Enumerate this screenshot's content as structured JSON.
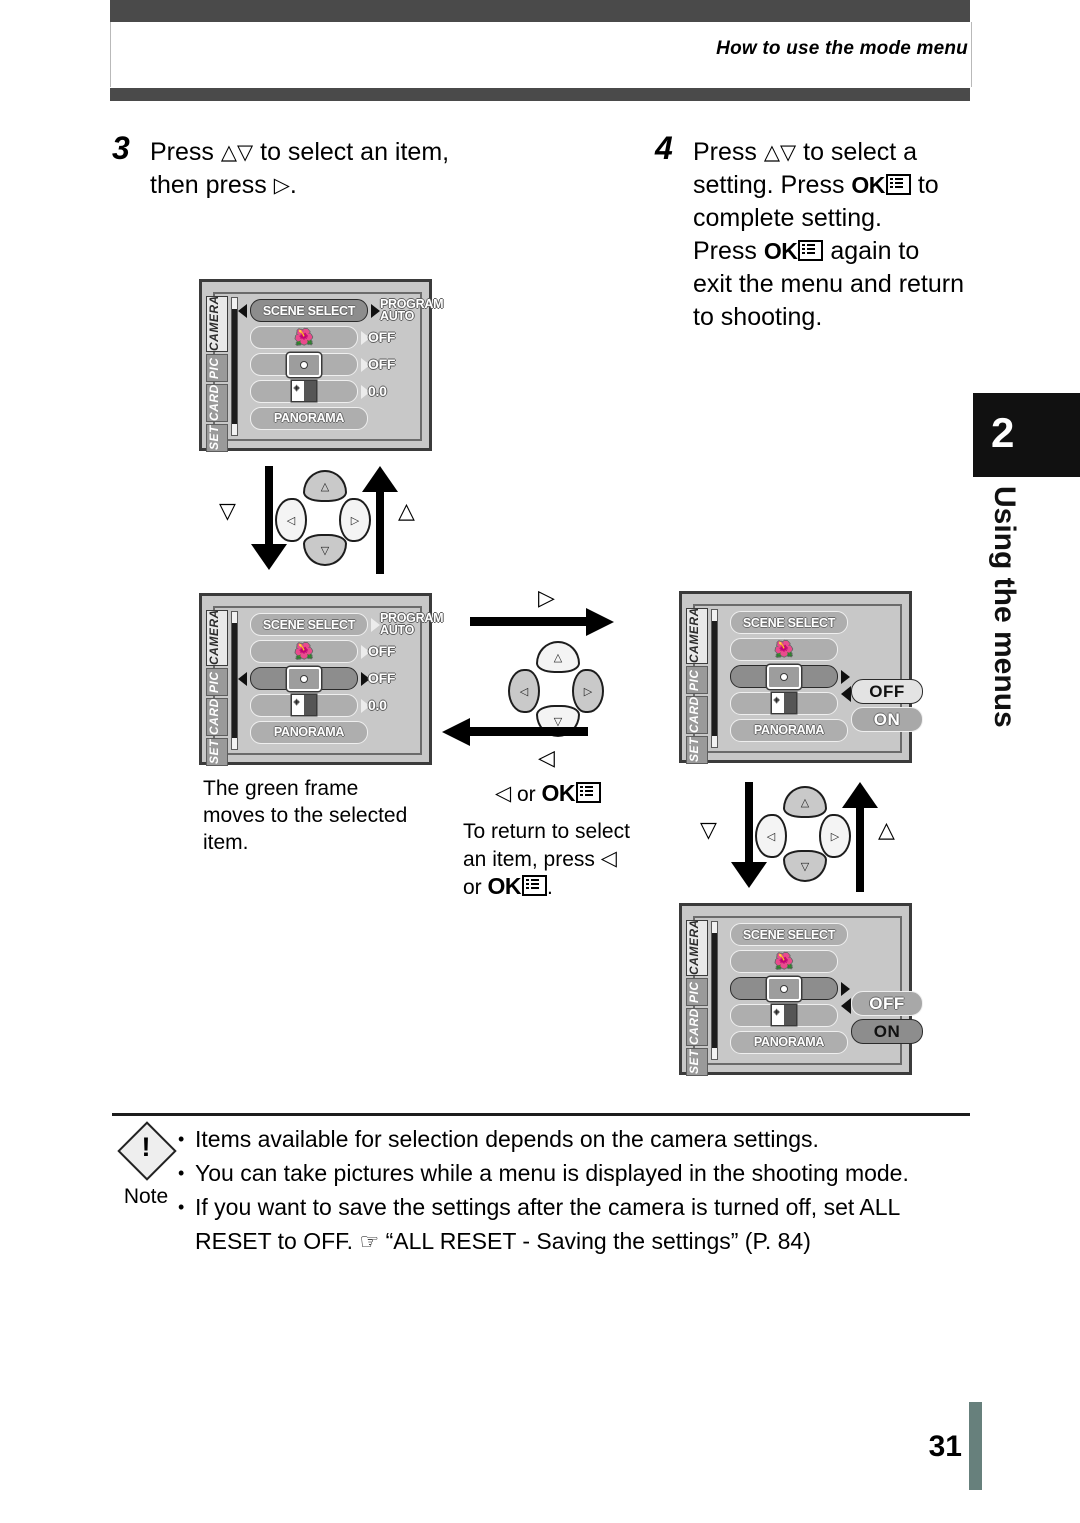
{
  "header": {
    "title": "How to use the mode menu"
  },
  "chapter": {
    "number": "2",
    "title": "Using the menus"
  },
  "steps": [
    {
      "number": "3",
      "line1_a": "Press",
      "line1_up": "△",
      "line1_down": "▽",
      "line1_b": "to select an item,",
      "line2_a": "then press",
      "line2_tri": "▷",
      "line2_b": "."
    },
    {
      "number": "4",
      "l1_a": "Press",
      "l1_up": "△",
      "l1_down": "▽",
      "l1_b": "to select a",
      "l2_a": "setting. Press",
      "l2_ok": "OK",
      "l2_b": "to",
      "l3": "complete setting.",
      "l4_a": "Press",
      "l4_ok": "OK",
      "l4_b": "again to",
      "l5": "exit the menu and return",
      "l6": "to shooting."
    }
  ],
  "lcd_tabs": [
    "CAMERA",
    "PIC",
    "CARD",
    "SET"
  ],
  "lcd_screens": {
    "screen1": {
      "rows": [
        {
          "label": "SCENE SELECT",
          "value": "PROGRAM\nAUTO",
          "value_l1": "PROGRAM",
          "value_l2": "AUTO",
          "selected": true
        },
        {
          "icon": "macro-icon",
          "value": "OFF",
          "selected": false
        },
        {
          "icon": "spot-metering-icon",
          "value": "OFF",
          "selected": false
        },
        {
          "icon": "exposure-compensation-icon",
          "value": "0.0",
          "selected": false
        },
        {
          "label": "PANORAMA",
          "value": "",
          "selected": false
        }
      ]
    },
    "screen2": {
      "rows": [
        {
          "label": "SCENE SELECT",
          "value_l1": "PROGRAM",
          "value_l2": "AUTO",
          "selected": false
        },
        {
          "icon": "macro-icon",
          "value": "OFF",
          "selected": false
        },
        {
          "icon": "spot-metering-icon",
          "value": "OFF",
          "selected": true
        },
        {
          "icon": "exposure-compensation-icon",
          "value": "0.0",
          "selected": false
        },
        {
          "label": "PANORAMA",
          "value": "",
          "selected": false
        }
      ]
    },
    "screen3": {
      "rows": [
        {
          "label": "SCENE SELECT",
          "selected": false
        },
        {
          "icon": "macro-icon",
          "selected": false
        },
        {
          "icon": "spot-metering-icon",
          "selected": true
        },
        {
          "icon": "exposure-compensation-icon",
          "selected": false
        },
        {
          "label": "PANORAMA",
          "selected": false
        }
      ],
      "options": [
        {
          "label": "OFF",
          "state": "highlighted"
        },
        {
          "label": "ON",
          "state": "dim"
        }
      ]
    },
    "screen4": {
      "rows": [
        {
          "label": "SCENE SELECT",
          "selected": false
        },
        {
          "icon": "macro-icon",
          "selected": false
        },
        {
          "icon": "spot-metering-icon",
          "selected": true
        },
        {
          "icon": "exposure-compensation-icon",
          "selected": false
        },
        {
          "label": "PANORAMA",
          "selected": false
        }
      ],
      "options": [
        {
          "label": "OFF",
          "state": "dim"
        },
        {
          "label": "ON",
          "state": "selected"
        }
      ]
    }
  },
  "arrow_labels": {
    "down": "▽",
    "up": "△",
    "right": "▷",
    "left": "◁"
  },
  "captions": {
    "green_frame_l1": "The green frame",
    "green_frame_l2": "moves to the selected",
    "green_frame_l3": "item.",
    "or_ok_left": "◁",
    "or_ok_word": "or",
    "or_ok_btn": "OK",
    "return_l1": "To return to select",
    "return_l2_a": "an item, press",
    "return_l2_tri": "◁",
    "return_l3_a": "or",
    "return_l3_ok": "OK",
    "return_l3_b": "."
  },
  "note": {
    "word": "Note",
    "bang": "!",
    "items": [
      "Items available for selection depends on the camera settings.",
      "You can take pictures while a menu is displayed in the shooting mode.",
      "If you want to save the settings after the camera is turned off, set ALL RESET to OFF."
    ],
    "reference_hand": "☞",
    "reference_text": "“ALL RESET - Saving the settings” (P. 84)"
  },
  "footer": {
    "page_number": "31"
  },
  "colors": {
    "header_bar": "#4a4a4a",
    "chapter_tab": "#111111",
    "page_bar": "#67807c",
    "lcd_bg": "#c8c8c8"
  }
}
